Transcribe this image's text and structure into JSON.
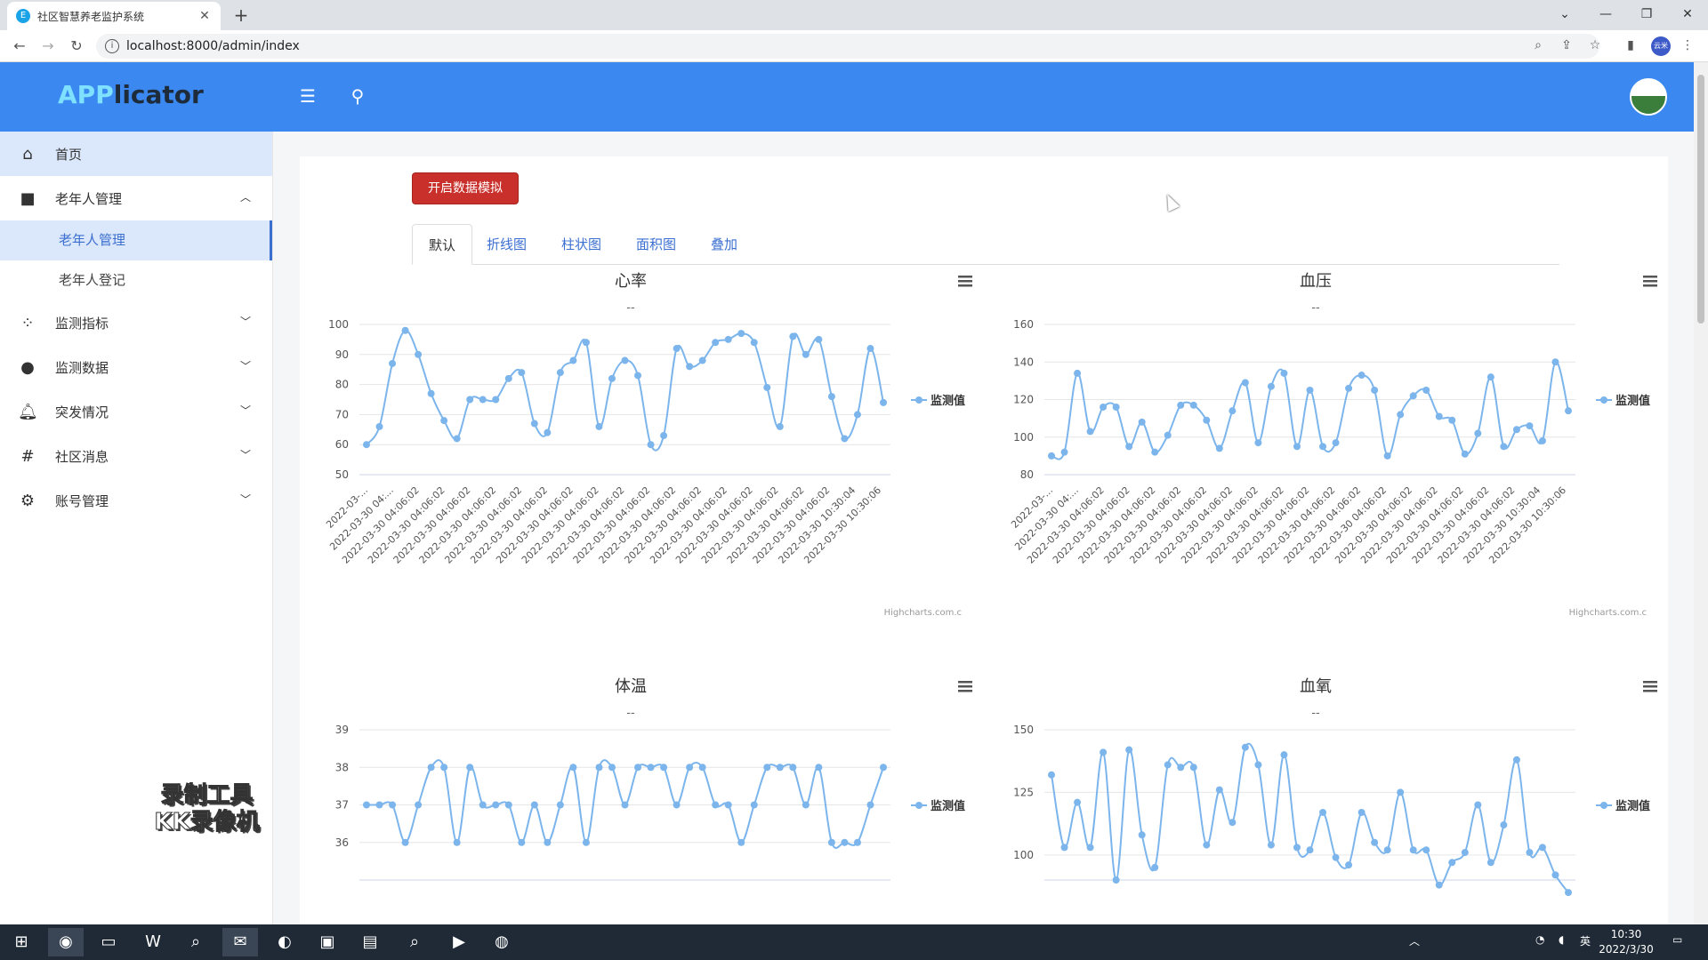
{
  "browser": {
    "tab_title": "社区智慧养老监护系统",
    "tab_favicon": "E",
    "tab_close": "✕",
    "new_tab": "+",
    "url": "localhost:8000/admin/index",
    "profile_label": "云米",
    "icons": [
      "back-arrow-icon",
      "forward-arrow-icon",
      "reload-icon",
      "info-icon",
      "zoom-icon",
      "share-icon",
      "star-icon",
      "sidepanel-icon",
      "kebab-menu-icon"
    ]
  },
  "app": {
    "logo_part1": "APP",
    "logo_part2": "licator",
    "accent": "#3b89f0",
    "sim_button": "开启数据模拟"
  },
  "sidebar": {
    "items": [
      {
        "label": "首页",
        "icon": "home-icon"
      },
      {
        "label": "老年人管理",
        "icon": "square-icon",
        "expanded": true
      },
      {
        "label": "监测指标",
        "icon": "spinner-icon"
      },
      {
        "label": "监测数据",
        "icon": "circle-icon"
      },
      {
        "label": "突发情况",
        "icon": "bell-icon"
      },
      {
        "label": "社区消息",
        "icon": "hash-icon"
      },
      {
        "label": "账号管理",
        "icon": "cogs-icon"
      }
    ],
    "subitems": [
      {
        "label": "老年人管理",
        "active": true
      },
      {
        "label": "老年人登记"
      }
    ]
  },
  "watermark": {
    "line1": "录制工具",
    "line2": "KK录像机"
  },
  "tabs": [
    "默认",
    "折线图",
    "柱状图",
    "面积图",
    "叠加"
  ],
  "chart_data": [
    {
      "type": "line",
      "title": "心率",
      "subtitle": "--",
      "ylim": [
        50,
        100
      ],
      "yticks": [
        50,
        60,
        70,
        80,
        90,
        100
      ],
      "xlabels": [
        "2022-03-...",
        "2022-03-30 04:...",
        "2022-03-30 04:06:02",
        "2022-03-30 04:06:02",
        "2022-03-30 04:06:02",
        "2022-03-30 04:06:02",
        "2022-03-30 04:06:02",
        "2022-03-30 04:06:02",
        "2022-03-30 04:06:02",
        "2022-03-30 04:06:02",
        "2022-03-30 04:06:02",
        "2022-03-30 04:06:02",
        "2022-03-30 04:06:02",
        "2022-03-30 04:06:02",
        "2022-03-30 04:06:02",
        "2022-03-30 04:06:02",
        "2022-03-30 04:06:02",
        "2022-03-30 04:06:02",
        "2022-03-30 04:06:02",
        "2022-03-30 10:30:04",
        "2022-03-30 10:30:06"
      ],
      "series": [
        {
          "name": "监测值",
          "values": [
            60,
            66,
            87,
            98,
            90,
            77,
            68,
            62,
            75,
            75,
            75,
            82,
            84,
            67,
            64,
            84,
            88,
            94,
            66,
            82,
            88,
            83,
            60,
            63,
            92,
            86,
            88,
            94,
            95,
            97,
            94,
            79,
            66,
            96,
            90,
            95,
            76,
            62,
            70,
            92,
            74
          ]
        }
      ],
      "legend": "right",
      "credits": "Highcharts.com.c"
    },
    {
      "type": "line",
      "title": "血压",
      "subtitle": "--",
      "ylim": [
        80,
        160
      ],
      "yticks": [
        80,
        100,
        120,
        140,
        160
      ],
      "xlabels": [
        "2022-03-...",
        "2022-03-30 04:...",
        "2022-03-30 04:06:02",
        "2022-03-30 04:06:02",
        "2022-03-30 04:06:02",
        "2022-03-30 04:06:02",
        "2022-03-30 04:06:02",
        "2022-03-30 04:06:02",
        "2022-03-30 04:06:02",
        "2022-03-30 04:06:02",
        "2022-03-30 04:06:02",
        "2022-03-30 04:06:02",
        "2022-03-30 04:06:02",
        "2022-03-30 04:06:02",
        "2022-03-30 04:06:02",
        "2022-03-30 04:06:02",
        "2022-03-30 04:06:02",
        "2022-03-30 04:06:02",
        "2022-03-30 04:06:02",
        "2022-03-30 10:30:04",
        "2022-03-30 10:30:06"
      ],
      "series": [
        {
          "name": "监测值",
          "values": [
            90,
            92,
            134,
            103,
            116,
            116,
            95,
            108,
            92,
            101,
            117,
            117,
            109,
            94,
            114,
            129,
            97,
            127,
            134,
            95,
            125,
            95,
            97,
            126,
            133,
            125,
            90,
            112,
            122,
            125,
            111,
            109,
            91,
            102,
            132,
            95,
            104,
            106,
            98,
            140,
            114
          ]
        }
      ],
      "legend": "right",
      "credits": "Highcharts.com.c"
    },
    {
      "type": "line",
      "title": "体温",
      "subtitle": "--",
      "ylim": [
        35,
        39
      ],
      "yticks": [
        36,
        37,
        38,
        39
      ],
      "series": [
        {
          "name": "监测值",
          "values": [
            37,
            37,
            37,
            36,
            37,
            38,
            38,
            36,
            38,
            37,
            37,
            37,
            36,
            37,
            36,
            37,
            38,
            36,
            38,
            38,
            37,
            38,
            38,
            38,
            37,
            38,
            38,
            37,
            37,
            36,
            37,
            38,
            38,
            38,
            37,
            38,
            36,
            36,
            36,
            37,
            38
          ]
        }
      ],
      "legend": "right"
    },
    {
      "type": "line",
      "title": "血氧",
      "subtitle": "--",
      "ylim": [
        90,
        150
      ],
      "yticks": [
        100,
        125,
        150
      ],
      "series": [
        {
          "name": "监测值",
          "values": [
            132,
            103,
            121,
            103,
            141,
            90,
            142,
            108,
            95,
            136,
            135,
            135,
            104,
            126,
            113,
            143,
            136,
            104,
            140,
            103,
            102,
            117,
            99,
            96,
            117,
            105,
            102,
            125,
            102,
            102,
            88,
            97,
            101,
            120,
            97,
            112,
            138,
            101,
            103,
            92,
            85
          ]
        }
      ],
      "legend": "right"
    }
  ],
  "taskbar": {
    "time": "10:30",
    "date": "2022/3/30",
    "ime": "英",
    "apps": [
      "windows-start-icon",
      "chrome-icon",
      "file-explorer-icon",
      "wps-icon",
      "search-app-icon",
      "wechat-icon",
      "app-green-icon",
      "game-icon",
      "notepad-icon",
      "browser-search-icon",
      "video-icon",
      "recorder-icon"
    ]
  }
}
